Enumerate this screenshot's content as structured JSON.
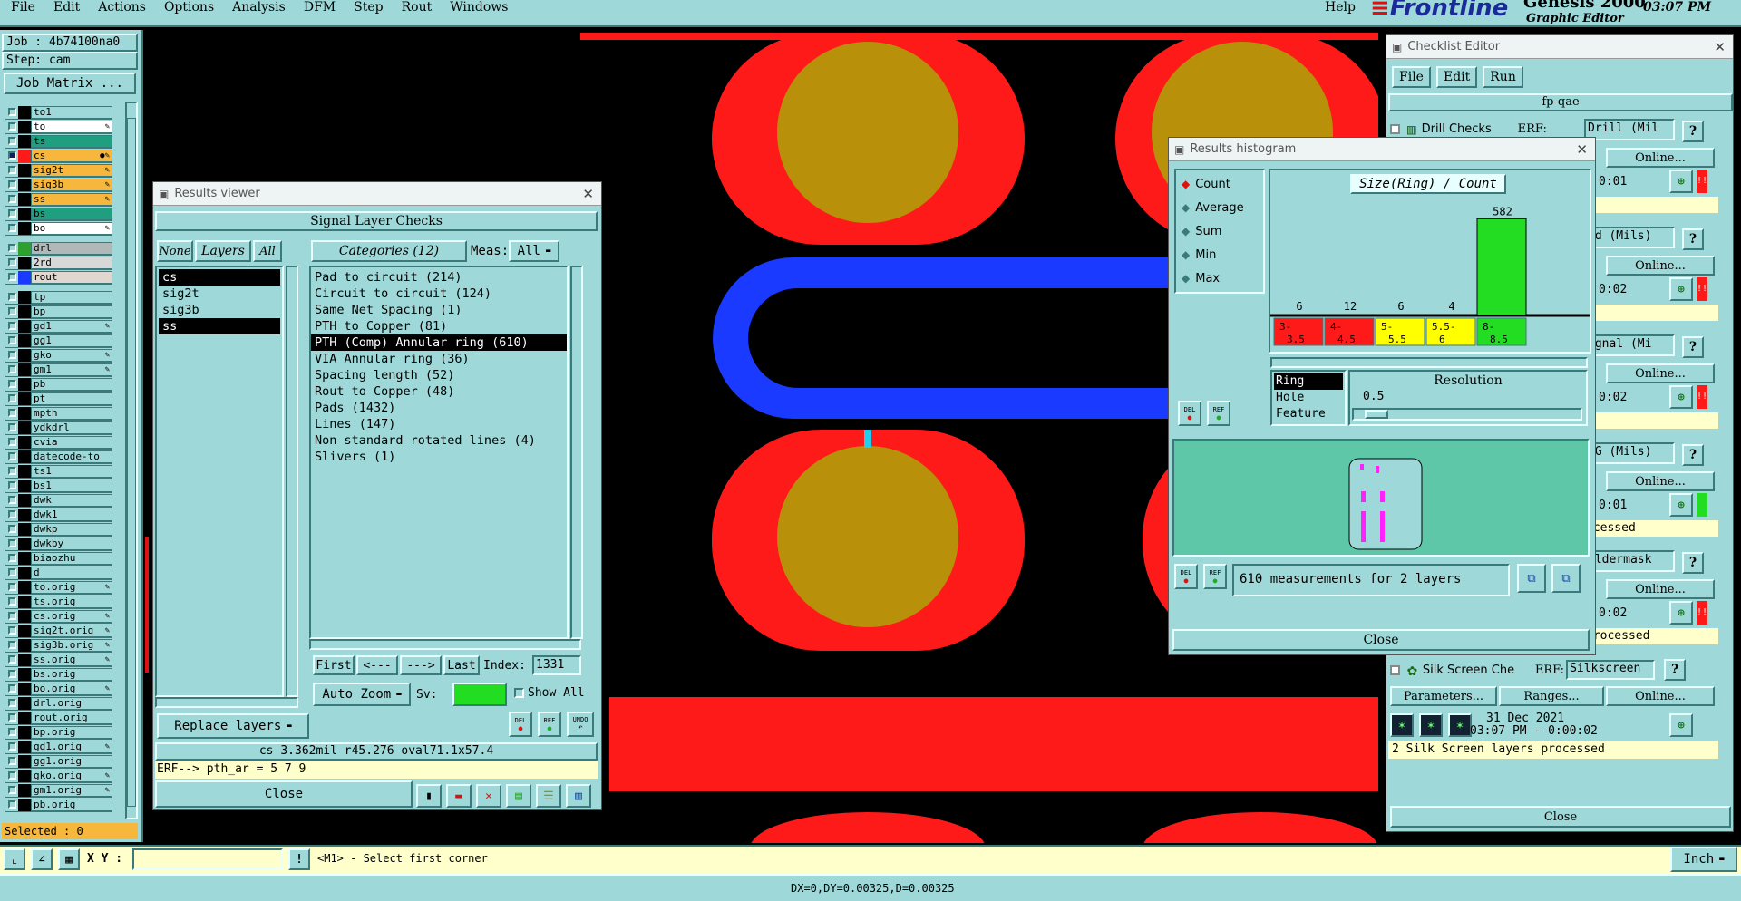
{
  "menu": {
    "items": [
      "File",
      "Edit",
      "Actions",
      "Options",
      "Analysis",
      "DFM",
      "Step",
      "Rout",
      "Windows"
    ],
    "help": "Help",
    "logo": "Frontline",
    "product": "Genesis 2000",
    "product_sub": "Graphic Editor",
    "time": "03:07 PM"
  },
  "job": {
    "job_label": "Job : 4b74100na0",
    "step_label": "Step: cam",
    "matrix_button": "Job Matrix ...",
    "selected": "Selected : 0"
  },
  "layers": [
    {
      "name": "to1",
      "color": "#000000",
      "bg": "#9fd8d8",
      "flag": ""
    },
    {
      "name": "to",
      "color": "#000000",
      "bg": "#ffffff",
      "flag": "✎"
    },
    {
      "name": "ts",
      "color": "#000000",
      "bg": "#1f9f7f",
      "flag": ""
    },
    {
      "name": "cs",
      "color": "#ff1a1a",
      "bg": "#f6b73c",
      "flag": "●✎",
      "active": true
    },
    {
      "name": "sig2t",
      "color": "#000000",
      "bg": "#f6b73c",
      "flag": "✎"
    },
    {
      "name": "sig3b",
      "color": "#000000",
      "bg": "#f6b73c",
      "flag": "✎"
    },
    {
      "name": "ss",
      "color": "#000000",
      "bg": "#f6b73c",
      "flag": "✎"
    },
    {
      "name": "bs",
      "color": "#000000",
      "bg": "#1f9f7f",
      "flag": ""
    },
    {
      "name": "bo",
      "color": "#000000",
      "bg": "#ffffff",
      "flag": "✎"
    },
    {
      "sep": true
    },
    {
      "name": "drl",
      "color": "#2ea02e",
      "bg": "#b0b8b8",
      "flag": ""
    },
    {
      "name": "2rd",
      "color": "#000000",
      "bg": "#d8d8d8",
      "flag": ""
    },
    {
      "name": "rout",
      "color": "#1a3aff",
      "bg": "#e0d8d0",
      "flag": ""
    },
    {
      "sep": true
    },
    {
      "name": "tp",
      "color": "#000000",
      "bg": "#9fd8d8",
      "flag": ""
    },
    {
      "name": "bp",
      "color": "#000000",
      "bg": "#9fd8d8",
      "flag": ""
    },
    {
      "name": "gd1",
      "color": "#000000",
      "bg": "#9fd8d8",
      "flag": "✎"
    },
    {
      "name": "gg1",
      "color": "#000000",
      "bg": "#9fd8d8",
      "flag": ""
    },
    {
      "name": "gko",
      "color": "#000000",
      "bg": "#9fd8d8",
      "flag": "✎"
    },
    {
      "name": "gm1",
      "color": "#000000",
      "bg": "#9fd8d8",
      "flag": "✎"
    },
    {
      "name": "pb",
      "color": "#000000",
      "bg": "#9fd8d8",
      "flag": ""
    },
    {
      "name": "pt",
      "color": "#000000",
      "bg": "#9fd8d8",
      "flag": ""
    },
    {
      "name": "mpth",
      "color": "#000000",
      "bg": "#9fd8d8",
      "flag": ""
    },
    {
      "name": "ydkdrl",
      "color": "#000000",
      "bg": "#9fd8d8",
      "flag": ""
    },
    {
      "name": "cvia",
      "color": "#000000",
      "bg": "#9fd8d8",
      "flag": ""
    },
    {
      "name": "datecode-to",
      "color": "#000000",
      "bg": "#9fd8d8",
      "flag": ""
    },
    {
      "name": "ts1",
      "color": "#000000",
      "bg": "#9fd8d8",
      "flag": ""
    },
    {
      "name": "bs1",
      "color": "#000000",
      "bg": "#9fd8d8",
      "flag": ""
    },
    {
      "name": "dwk",
      "color": "#000000",
      "bg": "#9fd8d8",
      "flag": ""
    },
    {
      "name": "dwk1",
      "color": "#000000",
      "bg": "#9fd8d8",
      "flag": ""
    },
    {
      "name": "dwkp",
      "color": "#000000",
      "bg": "#9fd8d8",
      "flag": ""
    },
    {
      "name": "dwkby",
      "color": "#000000",
      "bg": "#9fd8d8",
      "flag": ""
    },
    {
      "name": "biaozhu",
      "color": "#000000",
      "bg": "#9fd8d8",
      "flag": ""
    },
    {
      "name": "d",
      "color": "#000000",
      "bg": "#9fd8d8",
      "flag": ""
    },
    {
      "name": "to.orig",
      "color": "#000000",
      "bg": "#9fd8d8",
      "flag": "✎"
    },
    {
      "name": "ts.orig",
      "color": "#000000",
      "bg": "#9fd8d8",
      "flag": ""
    },
    {
      "name": "cs.orig",
      "color": "#000000",
      "bg": "#9fd8d8",
      "flag": "✎"
    },
    {
      "name": "sig2t.orig",
      "color": "#000000",
      "bg": "#9fd8d8",
      "flag": "✎"
    },
    {
      "name": "sig3b.orig",
      "color": "#000000",
      "bg": "#9fd8d8",
      "flag": "✎"
    },
    {
      "name": "ss.orig",
      "color": "#000000",
      "bg": "#9fd8d8",
      "flag": "✎"
    },
    {
      "name": "bs.orig",
      "color": "#000000",
      "bg": "#9fd8d8",
      "flag": ""
    },
    {
      "name": "bo.orig",
      "color": "#000000",
      "bg": "#9fd8d8",
      "flag": "✎"
    },
    {
      "name": "drl.orig",
      "color": "#000000",
      "bg": "#9fd8d8",
      "flag": ""
    },
    {
      "name": "rout.orig",
      "color": "#000000",
      "bg": "#9fd8d8",
      "flag": ""
    },
    {
      "name": "bp.orig",
      "color": "#000000",
      "bg": "#9fd8d8",
      "flag": ""
    },
    {
      "name": "gd1.orig",
      "color": "#000000",
      "bg": "#9fd8d8",
      "flag": "✎"
    },
    {
      "name": "gg1.orig",
      "color": "#000000",
      "bg": "#9fd8d8",
      "flag": ""
    },
    {
      "name": "gko.orig",
      "color": "#000000",
      "bg": "#9fd8d8",
      "flag": "✎"
    },
    {
      "name": "gm1.orig",
      "color": "#000000",
      "bg": "#9fd8d8",
      "flag": "✎"
    },
    {
      "name": "pb.orig",
      "color": "#000000",
      "bg": "#9fd8d8",
      "flag": ""
    }
  ],
  "results_viewer": {
    "title": "Results viewer",
    "header": "Signal Layer Checks",
    "btn_none": "None",
    "btn_layers": "Layers",
    "btn_all": "All",
    "categories_label": "Categories (12)",
    "meas_label": "Meas:",
    "meas_value": "All",
    "layer_list": [
      {
        "name": "cs",
        "selected": true
      },
      {
        "name": "sig2t",
        "selected": false
      },
      {
        "name": "sig3b",
        "selected": false
      },
      {
        "name": "ss",
        "selected": true
      }
    ],
    "categories": [
      {
        "text": "Pad to circuit (214)",
        "selected": false
      },
      {
        "text": "Circuit to circuit (124)",
        "selected": false
      },
      {
        "text": "Same Net Spacing (1)",
        "selected": false
      },
      {
        "text": "PTH to Copper (81)",
        "selected": false
      },
      {
        "text": "PTH (Comp) Annular ring (610)",
        "selected": true
      },
      {
        "text": "VIA Annular ring (36)",
        "selected": false
      },
      {
        "text": "Spacing length (52)",
        "selected": false
      },
      {
        "text": "Rout to Copper (48)",
        "selected": false
      },
      {
        "text": "Pads (1432)",
        "selected": false
      },
      {
        "text": "Lines (147)",
        "selected": false
      },
      {
        "text": "Non standard rotated lines (4)",
        "selected": false
      },
      {
        "text": "Slivers (1)",
        "selected": false
      }
    ],
    "first": "First",
    "prev": "<---",
    "next": "--->",
    "last": "Last",
    "index_label": "Index:",
    "index_value": "1331",
    "auto_zoom": "Auto Zoom",
    "sv_label": "Sv:",
    "show_all": "Show All",
    "replace_layers": "Replace layers",
    "status": "cs 3.362mil  r45.276  oval71.1x57.4",
    "erf": "ERF--> pth_ar = 5 7 9",
    "close": "Close",
    "del": "DEL",
    "ref": "REF",
    "undo": "UNDO"
  },
  "histogram": {
    "title": "Results histogram",
    "modes": [
      {
        "label": "Count",
        "selected": true
      },
      {
        "label": "Average",
        "selected": false
      },
      {
        "label": "Sum",
        "selected": false
      },
      {
        "label": "Min",
        "selected": false
      },
      {
        "label": "Max",
        "selected": false
      }
    ],
    "chart_title": "Size(Ring) / Count",
    "measure_options": [
      {
        "label": "Ring",
        "selected": true
      },
      {
        "label": "Hole",
        "selected": false
      },
      {
        "label": "Feature",
        "selected": false
      }
    ],
    "resolution_label": "Resolution",
    "resolution_value": "0.5",
    "summary": "610 measurements for 2 layers",
    "close": "Close",
    "del": "DEL",
    "ref": "REF"
  },
  "chart_data": {
    "type": "bar",
    "title": "Size(Ring) / Count",
    "categories": [
      "3-\n3.5",
      "4-\n4.5",
      "5-\n5.5",
      "5.5-\n6",
      "8-\n8.5"
    ],
    "values": [
      6,
      12,
      6,
      4,
      582
    ],
    "colors": [
      "#ff1a1a",
      "#ff1a1a",
      "#ffff00",
      "#ffff00",
      "#22dd22"
    ],
    "ylim": [
      0,
      600
    ]
  },
  "checklist": {
    "title": "Checklist Editor",
    "menu": [
      "File",
      "Edit",
      "Run"
    ],
    "name": "fp-qae",
    "items": [
      {
        "label": "Drill Checks",
        "erf": "ERF:",
        "field": "Drill (Mil",
        "online": "Online...",
        "time": "0:01",
        "status_text": ""
      },
      {
        "label": "",
        "erf": "",
        "field": "cd (Mils)",
        "online": "Online...",
        "time": "0:02",
        "status_text": ""
      },
      {
        "label": "",
        "erf": "",
        "field": "ignal (Mi",
        "online": "Online...",
        "time": "0:02",
        "status_text": ""
      },
      {
        "label": "",
        "erf": "",
        "field": "YG (Mils)",
        "online": "Online...",
        "time": "0:01",
        "status_text": "ocessed"
      },
      {
        "label": "",
        "erf": "",
        "field": "oldermask",
        "online": "Online...",
        "time": "0:02",
        "status_text": "processed"
      }
    ],
    "silk_label": "Silk Screen Che",
    "silk_erf": "ERF:",
    "silk_field": "Silkscreen",
    "parameters": "Parameters...",
    "ranges": "Ranges...",
    "online": "Online...",
    "date": "31 Dec 2021",
    "datetime": "03:07 PM - 0:00:02",
    "silk_status": "2 Silk Screen layers processed",
    "close": "Close",
    "help_q": "?",
    "run_mark": "!!"
  },
  "bottom": {
    "xy_label": "X Y :",
    "xy_value": "",
    "prompt": "<M1> - Select first corner",
    "units": "Inch",
    "coords": "DX=0,DY=0.00325,D=0.00325"
  },
  "colors": {
    "teal": "#9fd8d8",
    "pad_red": "#ff1a1a",
    "pad_gold": "#b8900a",
    "rout_blue": "#1a3aff"
  }
}
